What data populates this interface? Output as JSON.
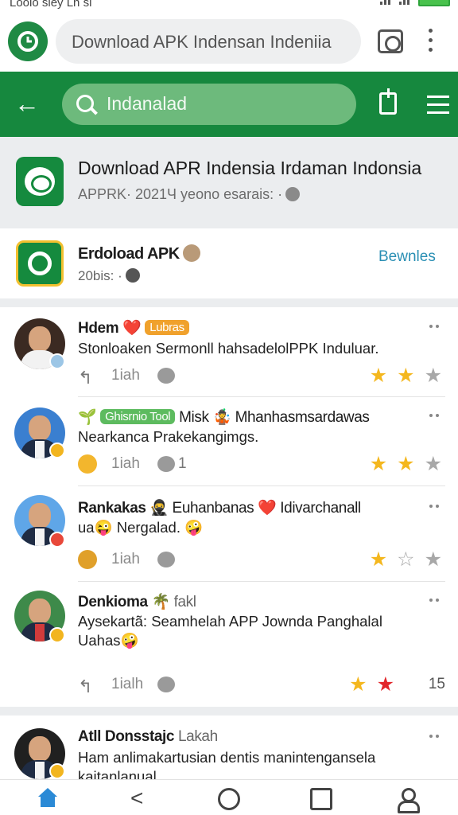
{
  "status_bar": {
    "carrier": "Loolo sley Ln sl"
  },
  "browser": {
    "url": "Download APK Indensan Indeniia"
  },
  "header": {
    "search_text": "Indanalad"
  },
  "app_info": {
    "title": "Download APR Indensia Irdaman Indonsia",
    "subtitle": "APPRK· 2021Ч yeono esarais: ·"
  },
  "download_card": {
    "title": "Erdoload APK",
    "meta": "20bis: ·",
    "action": "Bewnles"
  },
  "comments": [
    {
      "name": "Hdem",
      "emoji": "❤️",
      "tag": "Lubras",
      "tag_color": "#f0a12c",
      "text_lines": [
        "Stonloaken Sermonll hahsadelolPPK Induluar."
      ],
      "time": "1iah",
      "count": "",
      "stars": [
        "gold",
        "gold",
        "grey"
      ],
      "rating_count": ""
    },
    {
      "name": "Ghisrnio Tool",
      "name_suffix": "Misk 🤹 Mhanhasmsardawas",
      "tag_color": "#5dbb5f",
      "text_lines": [
        "Nearkanca Prakekangimgs."
      ],
      "time": "1iah",
      "count": "1",
      "stars": [
        "gold",
        "gold",
        "grey"
      ],
      "rating_count": ""
    },
    {
      "name": "Rankakas",
      "name_suffix": "🥷 Euhanbanas ❤️ Idivarchanall",
      "text_lines": [
        "ua😜 Nergalad. 🤪"
      ],
      "time": "1iah",
      "count": "",
      "stars": [
        "gold",
        "grey",
        "grey"
      ],
      "rating_count": ""
    },
    {
      "name": "Denkioma",
      "name_suffix": "🌴 fakl",
      "text_lines": [
        "Aysekartã: Seamhelah APP Jownda Panghalal",
        "Uahas🤪"
      ],
      "time": "1ialh",
      "count": "",
      "stars": [
        "gold",
        "red"
      ],
      "rating_count": "15"
    }
  ],
  "next_comment": {
    "name": "Atll Donsstajc",
    "name_suffix": "Lakah",
    "text_lines": [
      "Ham anlimakartusian dentis manintengansela",
      "kaitanlanual"
    ]
  },
  "icons": {
    "browser_logo": "clock-logo-icon",
    "tabs": "tabs-icon",
    "menu": "more-vert-icon",
    "back": "arrow-left-icon",
    "search": "search-icon",
    "share": "share-icon",
    "hamburger": "menu-icon",
    "nav": [
      "home-icon",
      "back-icon",
      "circle-home-icon",
      "book-icon",
      "profile-icon"
    ]
  },
  "colors": {
    "brand_green": "#16883e",
    "accent_blue": "#2a8fb4",
    "star_gold": "#f4b71e",
    "star_red": "#e2262a"
  }
}
